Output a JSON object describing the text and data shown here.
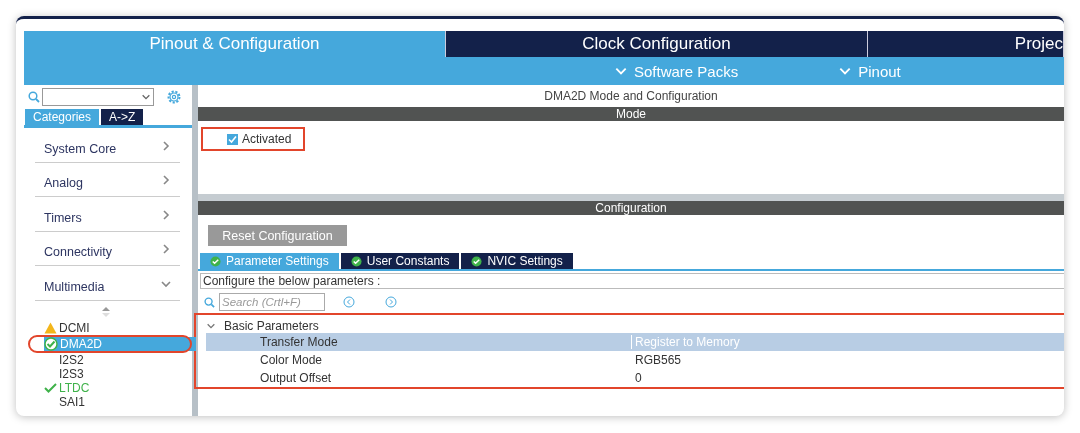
{
  "main_tabs": [
    {
      "label": "Pinout & Configuration",
      "selected": true
    },
    {
      "label": "Clock Configuration",
      "selected": false
    },
    {
      "label": "Projec",
      "selected": false
    }
  ],
  "sub_menu": [
    "Software Packs",
    "Pinout"
  ],
  "sidebar": {
    "view_tabs": [
      {
        "label": "Categories",
        "selected": true
      },
      {
        "label": "A->Z",
        "selected": false
      }
    ],
    "categories": [
      {
        "label": "System Core",
        "expanded": false
      },
      {
        "label": "Analog",
        "expanded": false
      },
      {
        "label": "Timers",
        "expanded": false
      },
      {
        "label": "Connectivity",
        "expanded": false
      },
      {
        "label": "Multimedia",
        "expanded": true
      }
    ],
    "peripherals": [
      {
        "label": "DCMI",
        "kind": "warning",
        "selected": false
      },
      {
        "label": "DMA2D",
        "kind": "configured",
        "selected": true
      },
      {
        "label": "I2S2",
        "kind": "plain",
        "selected": false
      },
      {
        "label": "I2S3",
        "kind": "plain",
        "selected": false
      },
      {
        "label": "LTDC",
        "kind": "enabled",
        "selected": false
      },
      {
        "label": "SAI1",
        "kind": "plain",
        "selected": false
      }
    ]
  },
  "panel_title": "DMA2D Mode and Configuration",
  "mode": {
    "header": "Mode",
    "activated": {
      "label": "Activated",
      "checked": true
    }
  },
  "configuration": {
    "header": "Configuration",
    "reset_button": "Reset Configuration",
    "tabs": [
      {
        "label": "Parameter Settings",
        "selected": true
      },
      {
        "label": "User Constants",
        "selected": false
      },
      {
        "label": "NVIC Settings",
        "selected": false
      }
    ],
    "hint": "Configure the below parameters :",
    "search": {
      "placeholder": "Search (Crtl+F)"
    },
    "group": {
      "label": "Basic Parameters",
      "expanded": true,
      "rows": [
        {
          "name": "Transfer Mode",
          "value": "Register to Memory",
          "selected": true
        },
        {
          "name": "Color Mode",
          "value": "RGB565",
          "selected": false
        },
        {
          "name": "Output Offset",
          "value": "0",
          "selected": false
        }
      ]
    }
  }
}
